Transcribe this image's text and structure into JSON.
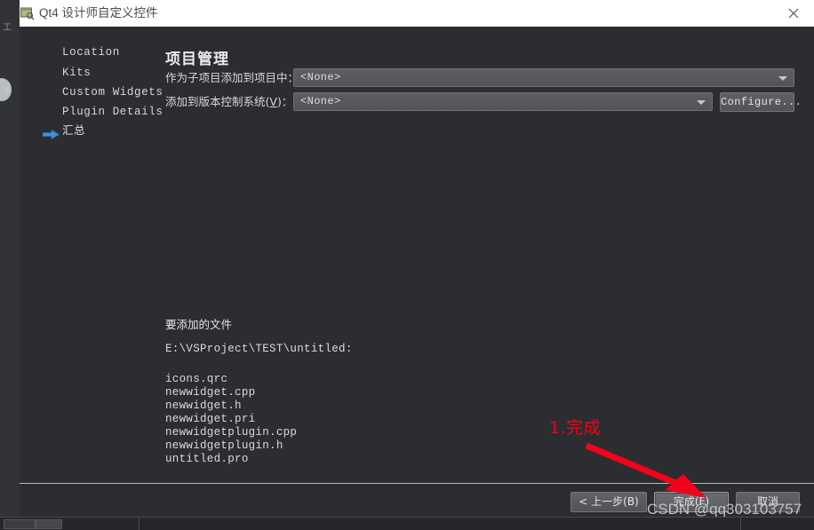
{
  "window": {
    "title": "Qt4 设计师自定义控件",
    "icon": "form-window-icon",
    "close_label": "×"
  },
  "sidebar": {
    "items": [
      {
        "label": "Location",
        "current": false
      },
      {
        "label": "Kits",
        "current": false
      },
      {
        "label": "Custom Widgets",
        "current": false
      },
      {
        "label": "Plugin Details",
        "current": false
      },
      {
        "label": "汇总",
        "current": true
      }
    ]
  },
  "main": {
    "page_title": "项目管理",
    "fields": [
      {
        "label_prefix": "作为子项目添加到项目中：",
        "label_mnemonic": "",
        "label_suffix": "",
        "value": "<None>",
        "has_configure": false
      },
      {
        "label_prefix": "添加到版本控制系统(",
        "label_mnemonic": "V",
        "label_suffix": ")：",
        "value": "<None>",
        "has_configure": true
      }
    ],
    "configure_button": "Configure...",
    "summary": {
      "heading": "要添加的文件",
      "path": "E:\\VSProject\\TEST\\untitled:",
      "files": [
        "icons.qrc",
        "newwidget.cpp",
        "newwidget.h",
        "newwidget.pri",
        "newwidgetplugin.cpp",
        "newwidgetplugin.h",
        "untitled.pro"
      ]
    }
  },
  "footer": {
    "buttons": [
      {
        "label": "< 上一步(B)",
        "focused": false
      },
      {
        "label": "完成(F)",
        "focused": true
      },
      {
        "label": "取消",
        "focused": false
      }
    ]
  },
  "annotations": {
    "step_label": "1.完成",
    "arrow_color": "#f3021c",
    "watermark": "CSDN @qq303103757"
  },
  "colors": {
    "dialog_background": "#2b2d30",
    "titlebar_background": "#ffffff",
    "accent_red": "#f3021c",
    "nav_arrow_blue": "#3f8fe0",
    "text_primary": "#d9dadc"
  }
}
